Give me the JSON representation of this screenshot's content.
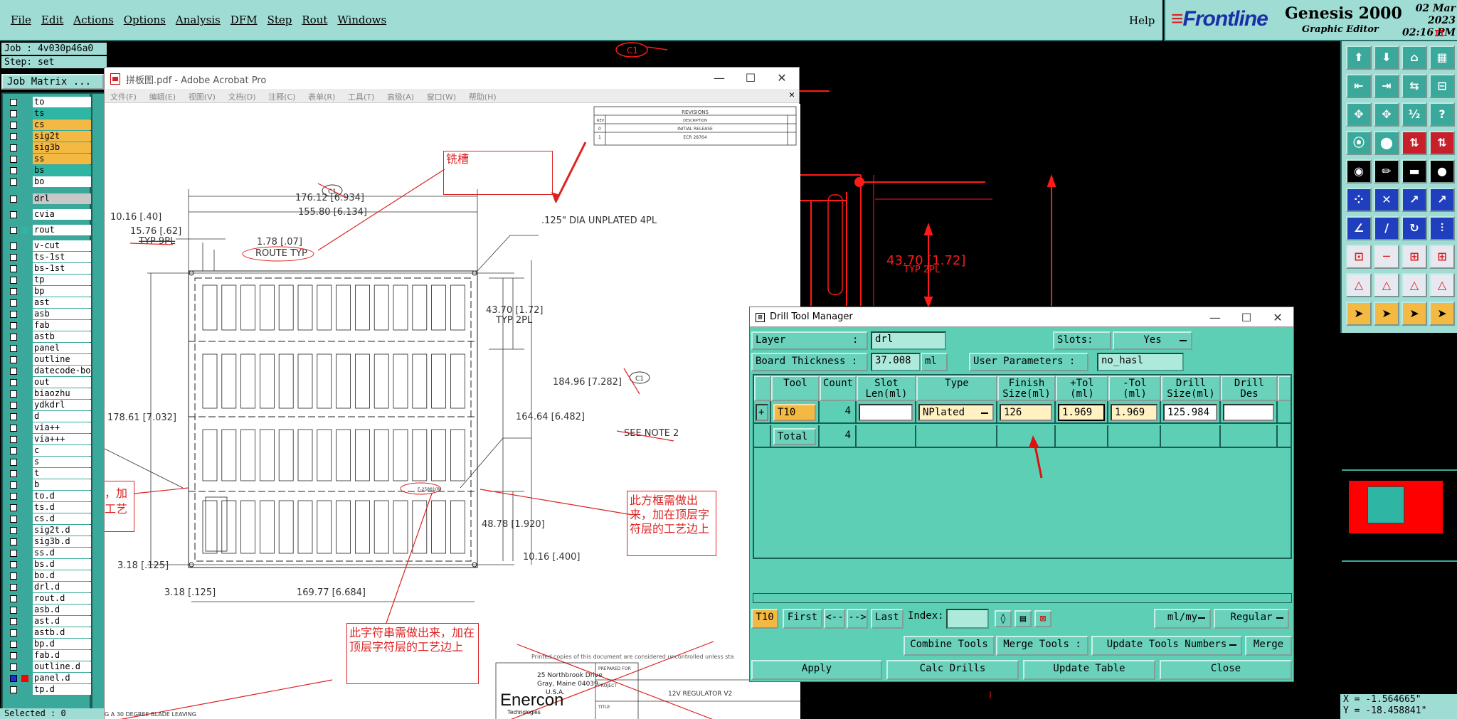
{
  "menubar": {
    "items": [
      "File",
      "Edit",
      "Actions",
      "Options",
      "Analysis",
      "DFM",
      "Step",
      "Rout",
      "Windows"
    ],
    "help": "Help"
  },
  "brand": {
    "logo": "Frontline",
    "product": "Genesis 2000",
    "subtitle": "Graphic Editor",
    "date": "02 Mar 2023",
    "time": "02:16 PM",
    "marker": "II"
  },
  "job": {
    "job_line": "Job : 4v030p46a0",
    "step_line": "Step: set",
    "matrix_button": "Job Matrix ...",
    "selected": "Selected : 0"
  },
  "layers": [
    {
      "name": "to",
      "color": "#ffffff"
    },
    {
      "name": "ts",
      "color": "#2fb5a3"
    },
    {
      "name": "cs",
      "color": "#f4b942"
    },
    {
      "name": "sig2t",
      "color": "#f4b942"
    },
    {
      "name": "sig3b",
      "color": "#f4b942"
    },
    {
      "name": "ss",
      "color": "#f4b942"
    },
    {
      "name": "bs",
      "color": "#2fb5a3"
    },
    {
      "name": "bo",
      "color": "#ffffff"
    },
    {
      "name": "drl",
      "color": "#c8c8c8"
    },
    {
      "name": "cvia",
      "color": "#ffffff"
    },
    {
      "name": "rout",
      "color": "#ffffff"
    },
    {
      "name": "v-cut",
      "color": "#ffffff"
    },
    {
      "name": "ts-1st",
      "color": "#ffffff"
    },
    {
      "name": "bs-1st",
      "color": "#ffffff"
    },
    {
      "name": "tp",
      "color": "#ffffff"
    },
    {
      "name": "bp",
      "color": "#ffffff"
    },
    {
      "name": "ast",
      "color": "#ffffff"
    },
    {
      "name": "asb",
      "color": "#ffffff"
    },
    {
      "name": "fab",
      "color": "#ffffff"
    },
    {
      "name": "astb",
      "color": "#ffffff"
    },
    {
      "name": "panel",
      "color": "#ffffff"
    },
    {
      "name": "outline",
      "color": "#ffffff"
    },
    {
      "name": "datecode-bo",
      "color": "#ffffff"
    },
    {
      "name": "out",
      "color": "#ffffff"
    },
    {
      "name": "biaozhu",
      "color": "#ffffff"
    },
    {
      "name": "ydkdrl",
      "color": "#ffffff"
    },
    {
      "name": "d",
      "color": "#ffffff"
    },
    {
      "name": "via++",
      "color": "#ffffff"
    },
    {
      "name": "via+++",
      "color": "#ffffff"
    },
    {
      "name": "c",
      "color": "#ffffff"
    },
    {
      "name": "s",
      "color": "#ffffff"
    },
    {
      "name": "t",
      "color": "#ffffff"
    },
    {
      "name": "b",
      "color": "#ffffff"
    },
    {
      "name": "to.d",
      "color": "#ffffff"
    },
    {
      "name": "ts.d",
      "color": "#ffffff"
    },
    {
      "name": "cs.d",
      "color": "#ffffff"
    },
    {
      "name": "sig2t.d",
      "color": "#ffffff"
    },
    {
      "name": "sig3b.d",
      "color": "#ffffff"
    },
    {
      "name": "ss.d",
      "color": "#ffffff"
    },
    {
      "name": "bs.d",
      "color": "#ffffff"
    },
    {
      "name": "bo.d",
      "color": "#ffffff"
    },
    {
      "name": "drl.d",
      "color": "#ffffff"
    },
    {
      "name": "rout.d",
      "color": "#ffffff"
    },
    {
      "name": "asb.d",
      "color": "#ffffff"
    },
    {
      "name": "ast.d",
      "color": "#ffffff"
    },
    {
      "name": "astb.d",
      "color": "#ffffff"
    },
    {
      "name": "bp.d",
      "color": "#ffffff"
    },
    {
      "name": "fab.d",
      "color": "#ffffff"
    },
    {
      "name": "outline.d",
      "color": "#ffffff"
    },
    {
      "name": "panel.d",
      "color": "#ffffff"
    },
    {
      "name": "tp.d",
      "color": "#ffffff"
    }
  ],
  "acrobat": {
    "title": "拼板图.pdf - Adobe Acrobat Pro",
    "menu": [
      "文件(F)",
      "编辑(E)",
      "视图(V)",
      "文档(D)",
      "注释(C)",
      "表单(R)",
      "工具(T)",
      "高级(A)",
      "窗口(W)",
      "帮助(H)"
    ],
    "revisions": {
      "title": "REVISIONS",
      "headers": [
        "REV",
        "DESCRIPTION"
      ],
      "rows": [
        [
          "0",
          "INITIAL RELEASE"
        ],
        [
          "1",
          "ECR 28764"
        ]
      ]
    },
    "dims": {
      "d1": "10.16 [.40]",
      "d2": "15.76 [.62]",
      "d3": "TYP 9PL",
      "d4": "176.12 [6.934]",
      "d5": "155.80 [6.134]",
      "d6": "1.78 [.07]",
      "d7": "ROUTE TYP",
      "d8": ".125\" DIA UNPLATED 4PL",
      "d9": "43.70 [1.72]",
      "d10": "TYP 2PL",
      "d11": "184.96 [7.282]",
      "d12": "178.61 [7.032]",
      "d13": "164.64 [6.482]",
      "d14": "SEE NOTE 2",
      "d15": "48.78 [1.920]",
      "d16": "10.16 [.400]",
      "d17": "3.18 [.125]",
      "d18": "3.18 [.125]",
      "d19": "169.77 [6.684]",
      "rev_bubble": "C1",
      "board_label": "F-25881(R)"
    },
    "notes": {
      "slot": "铣槽",
      "left_partial_1": "，加",
      "left_partial_2": "工艺",
      "frame_note": "此方框需做出来，加在顶层字符层的工艺边上",
      "string_note": "此字符串需做出来，加在顶层字符层的工艺边上"
    },
    "footer": {
      "printed": "Printed copies of this document are considered uncontrolled unless sta",
      "address1": "25 Northbrook Drive",
      "address2": "Gray, Maine 04039",
      "address3": "U.S.A.",
      "company": "Enercon",
      "company_sub": "Technologies",
      "prepared": "PREPARED FOR",
      "project": "PROJECT",
      "project_value": "12V REGULATOR V2",
      "title": "TITLE",
      "blade": "G A 30 DEGREE BLADE LEAVING"
    }
  },
  "cad": {
    "dim_label": "43.70 [1.72]",
    "dim_sub": "TYP 2PL",
    "rev_top": "C1"
  },
  "dtm": {
    "title": "Drill Tool Manager",
    "layer_label": "Layer",
    "layer_colon": ":",
    "layer_value": "drl",
    "slots_label": "Slots:",
    "slots_value": "Yes",
    "thick_label": "Board Thickness :",
    "thick_value": "37.008",
    "thick_unit": "ml",
    "user_params_label": "User Parameters :",
    "user_params_value": "no_hasl",
    "headers": [
      {
        "key": "tool",
        "label": "Tool"
      },
      {
        "key": "count",
        "label": "Count"
      },
      {
        "key": "slot",
        "label": "Slot\nLen(ml)"
      },
      {
        "key": "type",
        "label": "Type"
      },
      {
        "key": "finish",
        "label": "Finish\nSize(ml)"
      },
      {
        "key": "ptol",
        "label": "+Tol\n(ml)"
      },
      {
        "key": "ntol",
        "label": "-Tol\n(ml)"
      },
      {
        "key": "drill",
        "label": "Drill\nSize(ml)"
      },
      {
        "key": "des",
        "label": "Drill\nDes"
      }
    ],
    "row": {
      "tool": "T10",
      "count": "4",
      "slot": "",
      "type": "NPlated",
      "finish": "126",
      "ptol": "1.969",
      "ntol": "1.969",
      "drill": "125.984",
      "des": ""
    },
    "total": {
      "label": "Total",
      "count": "4"
    },
    "nav": {
      "current": "T10",
      "first": "First",
      "prev": "<--",
      "next": "-->",
      "last": "Last",
      "index": "Index:",
      "units": "ml/my",
      "mode": "Regular"
    },
    "actions": {
      "combine": "Combine Tools",
      "merge": "Merge Tools :",
      "update_nums": "Update Tools Numbers",
      "merge2": "Merge"
    },
    "bottom": {
      "apply": "Apply",
      "calc": "Calc Drills",
      "update": "Update Table",
      "close": "Close"
    }
  },
  "coords": {
    "x": "X = -1.564665\"",
    "y": "Y = -18.458841\""
  },
  "colors": {
    "teal": "#5ccfb4",
    "menu": "#9fdcd4",
    "red": "#d22222",
    "cad_red": "#ff1a1a"
  }
}
